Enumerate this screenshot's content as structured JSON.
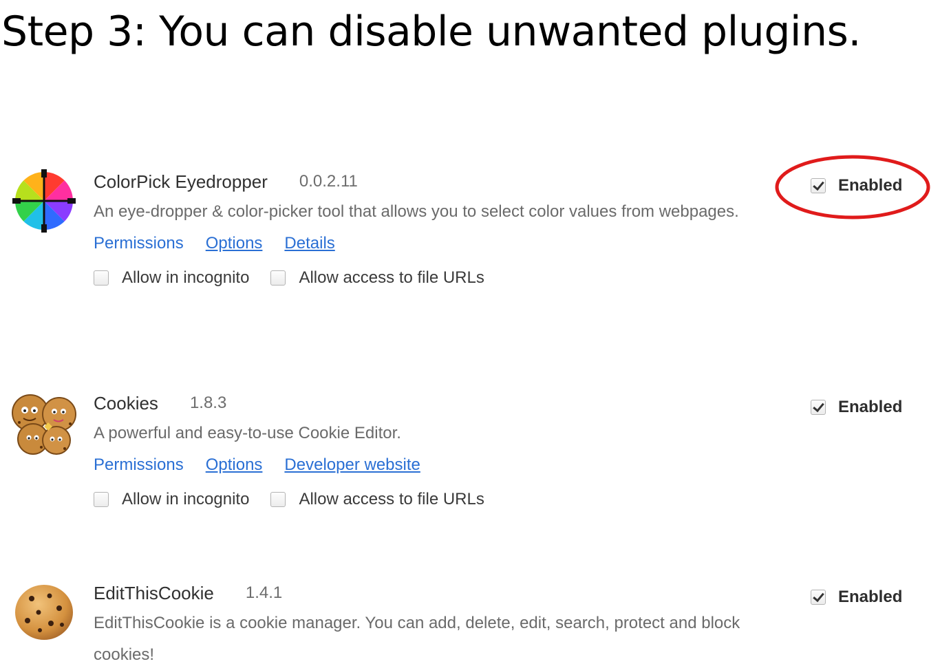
{
  "page": {
    "title": "Step 3: You can disable unwanted plugins."
  },
  "extensions": [
    {
      "name": "ColorPick Eyedropper",
      "version": "0.0.2.11",
      "description": "An eye-dropper & color-picker tool that allows you to select color values from webpages.",
      "links": [
        "Permissions",
        "Options",
        "Details"
      ],
      "options": [
        "Allow in incognito",
        "Allow access to file URLs"
      ],
      "enabled_label": "Enabled",
      "enabled": true,
      "icon": "color-wheel-icon"
    },
    {
      "name": "Cookies",
      "version": "1.8.3",
      "description": "A powerful and easy-to-use Cookie Editor.",
      "links": [
        "Permissions",
        "Options",
        "Developer website"
      ],
      "options": [
        "Allow in incognito",
        "Allow access to file URLs"
      ],
      "enabled_label": "Enabled",
      "enabled": true,
      "icon": "cookie-faces-icon"
    },
    {
      "name": "EditThisCookie",
      "version": "1.4.1",
      "description": "EditThisCookie is a cookie manager. You can add, delete, edit, search, protect and block cookies!",
      "enabled_label": "Enabled",
      "enabled": true,
      "icon": "cookie-icon"
    }
  ],
  "colors": {
    "link": "#2a6fd4",
    "highlight": "#e01b1b"
  }
}
